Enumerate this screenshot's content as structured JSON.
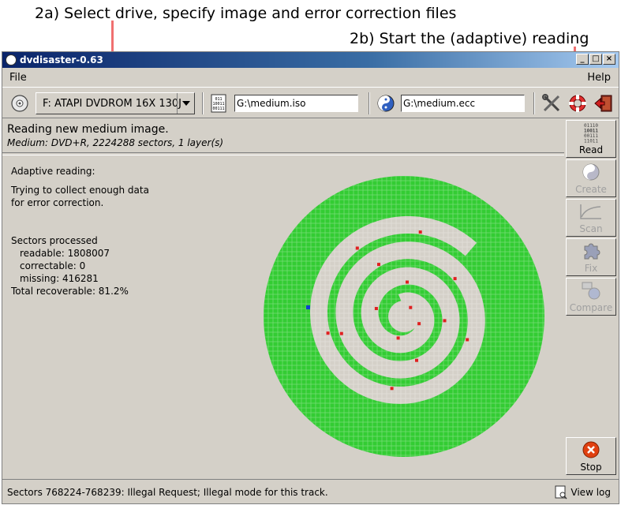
{
  "annotations": {
    "a": "2a) Select drive, specify image and error correction files",
    "b": "2b) Start the (adaptive) reading"
  },
  "window": {
    "title": "dvdisaster-0.63"
  },
  "menu": {
    "file": "File",
    "help": "Help"
  },
  "toolbar": {
    "drive": "F: ATAPI DVDROM 16X 130J",
    "image_file": "G:\\medium.iso",
    "ecc_file": "G:\\medium.ecc"
  },
  "status": {
    "title": "Reading new medium image.",
    "subtitle": "Medium: DVD+R, 2224288 sectors, 1 layer(s)"
  },
  "info": {
    "mode": "Adaptive reading:",
    "desc1": "Trying to collect enough data",
    "desc2": "for error correction.",
    "sectors_heading": "Sectors processed",
    "readable": "readable: 1808007",
    "correctable": "correctable: 0",
    "missing": "missing: 416281",
    "total": "Total recoverable: 81.2%"
  },
  "sidebar": {
    "read": "Read",
    "create": "Create",
    "scan": "Scan",
    "fix": "Fix",
    "compare": "Compare",
    "stop": "Stop",
    "read_icon_text": [
      "01110",
      "10011",
      "00111",
      "11011"
    ]
  },
  "statusbar": {
    "message": "Sectors 768224-768239: Illegal Request; Illegal mode for this track.",
    "view_log": "View log"
  },
  "colors": {
    "readable": "#33cc33",
    "unread": "#d4d0c8",
    "error": "#e02020",
    "current": "#1040d0",
    "annotation_line": "#f07070"
  },
  "icons": [
    "dvd-icon",
    "file-image-icon",
    "ecc-file-icon",
    "tools-icon",
    "lifebuoy-icon",
    "exit-icon",
    "view-log-icon"
  ]
}
